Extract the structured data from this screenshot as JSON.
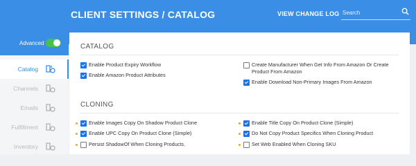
{
  "header": {
    "title": "CLIENT SETTINGS  /  CATALOG",
    "view_change_log": "VIEW CHANGE LOG",
    "search_placeholder": "Search",
    "accent": "#3a8ee6"
  },
  "sidebar": {
    "advanced_label": "Advanced",
    "advanced_on": true,
    "items": [
      {
        "label": "Catalog",
        "icon": "catalog-icon",
        "active": true
      },
      {
        "label": "Channels",
        "icon": "channels-icon",
        "active": false
      },
      {
        "label": "Emails",
        "icon": "emails-icon",
        "active": false
      },
      {
        "label": "Fulfillment",
        "icon": "fulfillment-icon",
        "active": false
      },
      {
        "label": "Inventory",
        "icon": "inventory-icon",
        "active": false
      }
    ]
  },
  "catalog": {
    "title": "CATALOG",
    "options": [
      {
        "label": "Enable Product Expiry Workflow",
        "checked": true
      },
      {
        "label": "Enable Amazon Product Attributes",
        "checked": true
      },
      {
        "label": "Create Manufacturer When Get Info From Amazon Or Create",
        "label2": "Product From Amazon",
        "checked": false
      },
      {
        "label": "Enable Download Non-Primary Images From Amazon",
        "checked": true
      }
    ]
  },
  "cloning": {
    "title": "CLONING",
    "options": [
      {
        "label": "Enable Images Copy On Shadow Product Clone",
        "checked": true
      },
      {
        "label": "Enable UPC Copy On Product Clone (Simple)",
        "checked": true
      },
      {
        "label": "Persist ShadowOf When Cloning Products.",
        "checked": false
      },
      {
        "label": "Enable Title Copy On Product Clone (Simple)",
        "checked": true
      },
      {
        "label": "Do Not Copy Product Specifics When Cloning Product",
        "checked": true
      },
      {
        "label": "Set Web Enabled When Cloning SKU",
        "checked": false
      }
    ]
  }
}
